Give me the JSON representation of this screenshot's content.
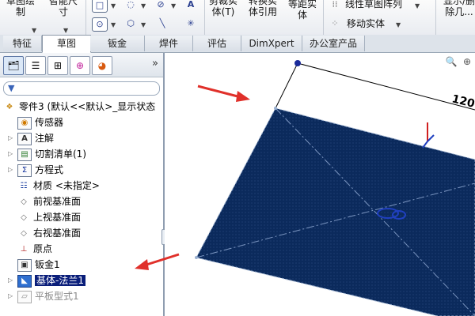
{
  "toolbar": {
    "btn1_line1": "草图绘",
    "btn1_line2": "制",
    "btn2_line1": "智能尺",
    "btn2_line2": "寸",
    "mirror_line1": "剪裁实",
    "mirror_line2": "体(T)",
    "convert_line1": "转换实",
    "convert_line2": "体引用",
    "offset_line1": "等距实",
    "offset_line2": "体",
    "linear_pattern": "线性草图阵列",
    "move_entities": "移动实体",
    "right_line1": "显示/删",
    "right_line2": "除几..."
  },
  "tabs": [
    "特征",
    "草图",
    "钣金",
    "焊件",
    "评估",
    "DimXpert",
    "办公室产品"
  ],
  "active_tab": "草图",
  "feature_tree": {
    "root": "零件3 (默认<<默认>_显示状态",
    "items": [
      {
        "label": "传感器",
        "icon": "sensor-icon"
      },
      {
        "label": "注解",
        "icon": "annotation-icon"
      },
      {
        "label": "切割清单(1)",
        "icon": "cut-list-icon"
      },
      {
        "label": "方程式",
        "icon": "equation-icon"
      },
      {
        "label": "材质 <未指定>",
        "icon": "material-icon"
      },
      {
        "label": "前视基准面",
        "icon": "plane-icon"
      },
      {
        "label": "上视基准面",
        "icon": "plane-icon"
      },
      {
        "label": "右视基准面",
        "icon": "plane-icon"
      },
      {
        "label": "原点",
        "icon": "origin-icon"
      },
      {
        "label": "钣金1",
        "icon": "sheet-metal-icon"
      },
      {
        "label": "基体-法兰1",
        "icon": "base-flange-icon"
      },
      {
        "label": "平板型式1",
        "icon": "flat-pattern-icon"
      }
    ]
  },
  "graphics": {
    "dimension_text": "120",
    "panel_color": "#0b2a5c",
    "arrow_color": "#e0302a"
  }
}
